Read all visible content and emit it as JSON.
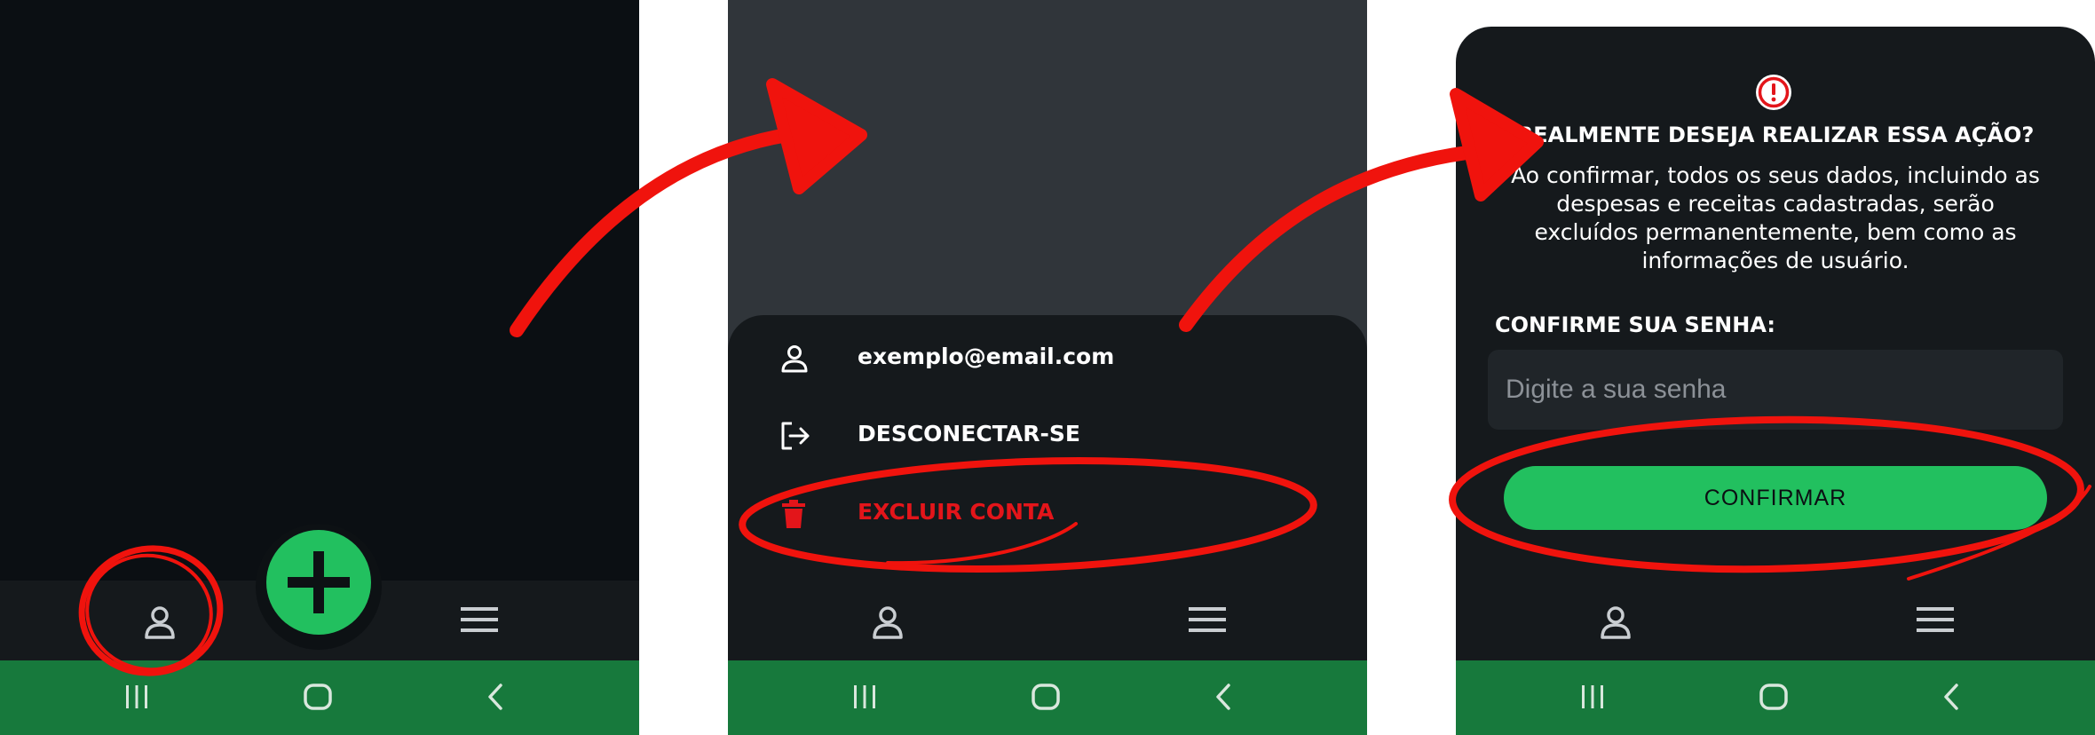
{
  "colors": {
    "accent_green": "#22c05f",
    "system_bar": "#17793c",
    "danger": "#e3151a",
    "annotation": "#f0130d",
    "surface": "#15191c"
  },
  "icons": {
    "user": "user-icon",
    "menu": "hamburger-menu-icon",
    "add": "plus-icon",
    "logout": "logout-icon",
    "delete": "trash-icon",
    "alert": "alert-circle-icon",
    "recent_apps": "recent-apps-icon",
    "home": "home-icon",
    "back": "back-icon"
  },
  "account_menu": {
    "email": "exemplo@email.com",
    "logout_label": "DESCONECTAR-SE",
    "delete_label": "EXCLUIR CONTA"
  },
  "confirm_dialog": {
    "title": "REALMENTE DESEJA REALIZAR ESSA AÇÃO?",
    "body": "Ao confirmar, todos os seus dados, incluindo as despesas e receitas cadastradas, serão excluídos permanentemente, bem como as informações de usuário.",
    "password_label": "CONFIRME SUA SENHA:",
    "password_placeholder": "Digite a sua senha",
    "password_value": "",
    "confirm_button": "CONFIRMAR"
  }
}
